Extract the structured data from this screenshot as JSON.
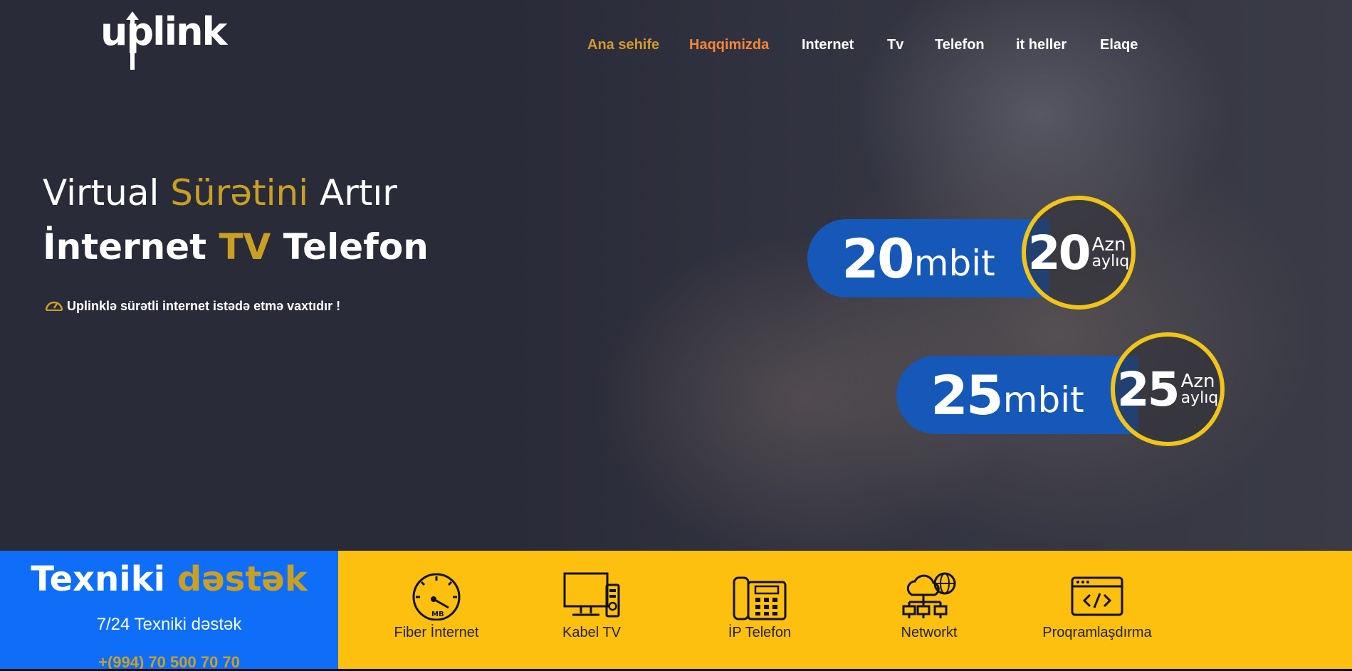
{
  "brand": {
    "logo_text": "uplink"
  },
  "nav": {
    "items": [
      {
        "label": "Ana sehife",
        "color": "#d39a2c"
      },
      {
        "label": "Haqqimizda",
        "color": "#f5863a"
      },
      {
        "label": "Internet",
        "color": "#ffffff"
      },
      {
        "label": "Tv",
        "color": "#ffffff"
      },
      {
        "label": "Telefon",
        "color": "#ffffff"
      },
      {
        "label": "it heller",
        "color": "#ffffff"
      },
      {
        "label": "Elaqe",
        "color": "#ffffff"
      }
    ]
  },
  "hero": {
    "line1_a": "Virtual ",
    "line1_highlight": "Sürətini",
    "line1_b": " Artır",
    "line2_a": "İnternet ",
    "line2_highlight": "TV",
    "line2_b": " Telefon",
    "tagline": "Uplinklə sürətli internet istədə etmə vaxtıdır !",
    "tagline_icon": "speedometer-icon"
  },
  "offers": [
    {
      "speed": "20",
      "unit": "mbit",
      "price": "20",
      "currency": "Azn",
      "period": "aylıq"
    },
    {
      "speed": "25",
      "unit": "mbit",
      "price": "25",
      "currency": "Azn",
      "period": "aylıq"
    }
  ],
  "support": {
    "title_a": "Texniki ",
    "title_highlight": "dəstək",
    "subtitle": "7/24 Texniki dəstək",
    "phone": "+(994) 70 500 70 70"
  },
  "services": [
    {
      "label": "Fiber İnternet",
      "icon": "speedometer-mb-icon"
    },
    {
      "label": "Kabel TV",
      "icon": "tv-icon"
    },
    {
      "label": "İP Telefon",
      "icon": "desk-phone-icon"
    },
    {
      "label": "Networkt",
      "icon": "network-cloud-icon"
    },
    {
      "label": "Proqramlaşdırma",
      "icon": "code-window-icon"
    }
  ],
  "colors": {
    "accent_gold": "#c9a024",
    "support_blue": "#0f6ef8",
    "services_yellow": "#fec00e",
    "offer_blue": "#1558b8",
    "ring_yellow": "#f0c419"
  }
}
